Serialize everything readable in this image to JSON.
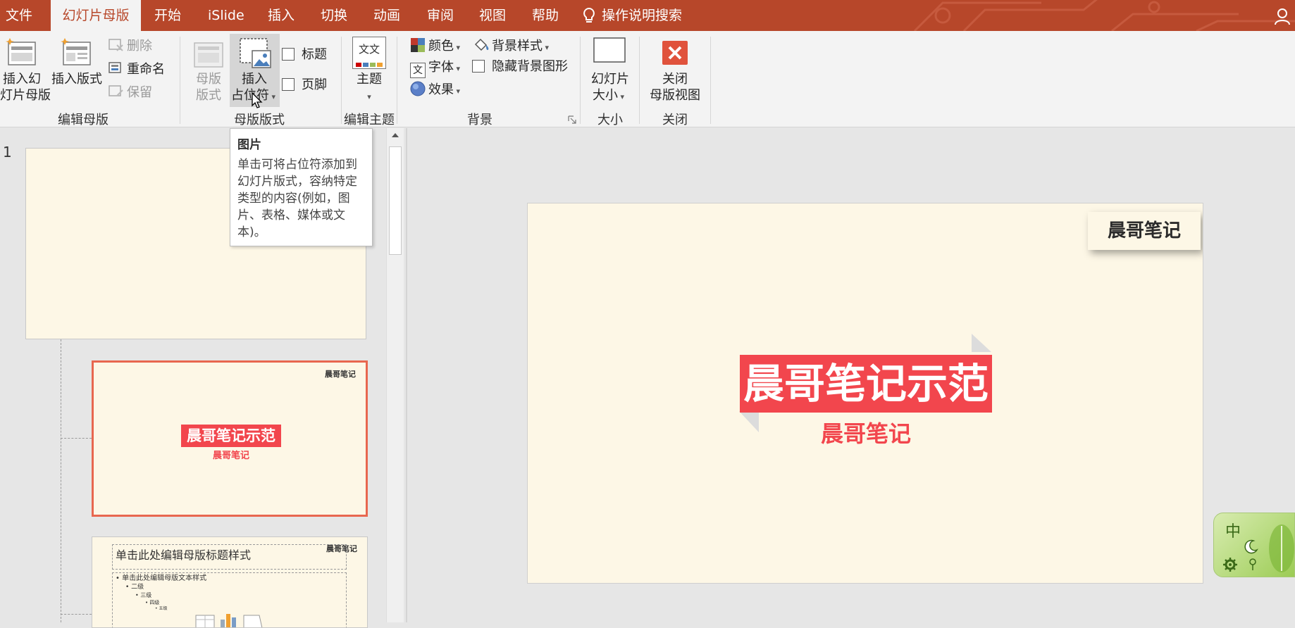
{
  "tabs": [
    {
      "label": "文件"
    },
    {
      "label": "幻灯片母版"
    },
    {
      "label": "开始"
    },
    {
      "label": "iSlide"
    },
    {
      "label": "插入"
    },
    {
      "label": "切换"
    },
    {
      "label": "动画"
    },
    {
      "label": "审阅"
    },
    {
      "label": "视图"
    },
    {
      "label": "帮助"
    }
  ],
  "search_label": "操作说明搜索",
  "ribbon": {
    "edit_master": {
      "label": "编辑母版",
      "insert_slide_master": [
        "插入幻",
        "灯片母版"
      ],
      "insert_layout": "插入版式",
      "delete": "删除",
      "rename": "重命名",
      "preserve": "保留"
    },
    "master_layout": {
      "label": "母版版式",
      "master_layout_btn": [
        "母版",
        "版式"
      ],
      "insert_placeholder": [
        "插入",
        "占位符"
      ],
      "title_checkbox": "标题",
      "footer_checkbox": "页脚"
    },
    "edit_theme": {
      "label": "编辑主题",
      "theme": "主题",
      "theme_icon_text": "文文"
    },
    "background": {
      "label": "背景",
      "colors": "颜色",
      "fonts": "字体",
      "effects": "效果",
      "background_styles": "背景样式",
      "hide_background_graphics": "隐藏背景图形",
      "font_icon_text": "文"
    },
    "size": {
      "label": "大小",
      "slide_size": [
        "幻灯片",
        "大小"
      ]
    },
    "close": {
      "label": "关闭",
      "close_master_view": [
        "关闭",
        "母版视图"
      ]
    }
  },
  "tooltip": {
    "title": "图片",
    "body": "单击可将占位符添加到幻灯片版式，容纳特定类型的内容(例如，图片、表格、媒体或文本)。"
  },
  "thumbnails": {
    "slide_number": "1",
    "thumb2": {
      "title": "晨哥笔记示范",
      "subtitle": "晨哥笔记",
      "corner": "晨哥笔记"
    },
    "thumb3": {
      "corner": "晨哥笔记",
      "title": "单击此处编辑母版标题样式",
      "body_levels": [
        "• 单击此处编辑母版文本样式",
        "• 二级",
        "• 三级",
        "• 四级",
        "• 五级"
      ]
    }
  },
  "main_slide": {
    "corner_label": "晨哥笔记",
    "title": "晨哥笔记示范",
    "subtitle": "晨哥笔记"
  },
  "ime": {
    "label": "中"
  },
  "colors": {
    "accent": "#b7472a",
    "title_banner": "#f2464d",
    "slide_bg": "#fdf7e6",
    "close_red": "#e0523c"
  }
}
